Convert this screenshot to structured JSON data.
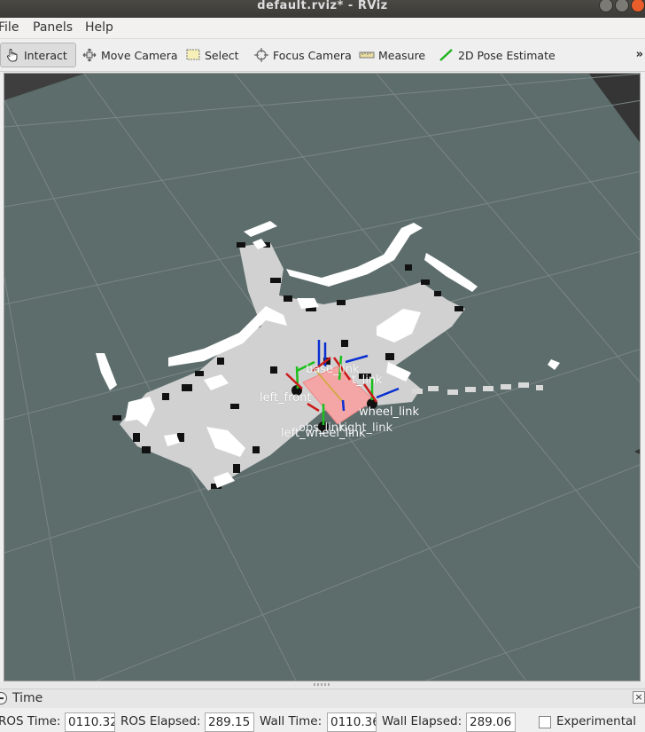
{
  "window": {
    "title": "default.rviz* - RViz"
  },
  "menu": {
    "file": "File",
    "panels": "Panels",
    "help": "Help"
  },
  "toolbar": {
    "interact": "Interact",
    "move_camera": "Move Camera",
    "select": "Select",
    "focus_camera": "Focus Camera",
    "measure": "Measure",
    "pose_estimate": "2D Pose Estimate",
    "overflow": "»"
  },
  "viewport": {
    "labels": {
      "left_front": "left_front",
      "left_wheel_link": "left_wheel_link",
      "right_wheel_link": "wheel_link",
      "overlap_a": "obs_link",
      "overlap_b": "right_link",
      "lidar_mark": "t_link",
      "base_link": "base_link"
    },
    "colors": {
      "floor": "#5d6d6c",
      "map_free": "#d0d0d0",
      "map_occupied": "#111111",
      "robot": "#f4a6a6"
    }
  },
  "time_panel": {
    "title": "Time",
    "ros_time_label": "ROS Time:",
    "ros_time_value": "0110.32",
    "ros_elapsed_label": "ROS Elapsed:",
    "ros_elapsed_value": "289.15",
    "wall_time_label": "Wall Time:",
    "wall_time_value": "0110.36",
    "wall_elapsed_label": "Wall Elapsed:",
    "wall_elapsed_value": "289.06",
    "experimental_label": "Experimental"
  }
}
